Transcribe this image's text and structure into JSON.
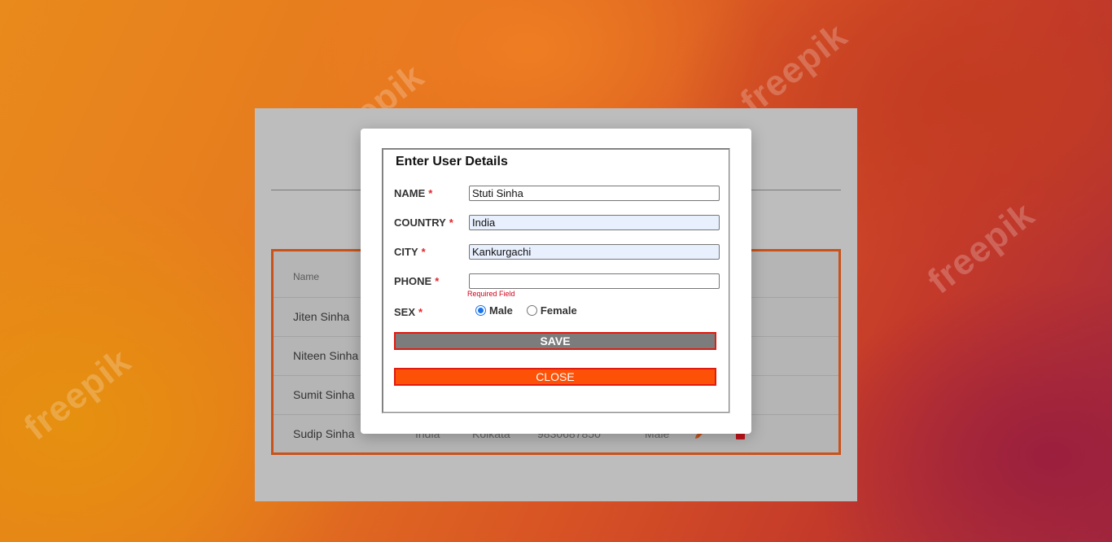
{
  "watermark": "freepik",
  "background_card": {
    "table": {
      "header_name": "Name",
      "rows": [
        {
          "name": "Jiten Sinha"
        },
        {
          "name": "Niteen Sinha"
        },
        {
          "name": "Sumit Sinha"
        },
        {
          "name": "Sudip Sinha",
          "country": "India",
          "city": "Kolkata",
          "phone": "9830687850",
          "sex": "Male"
        }
      ]
    }
  },
  "modal": {
    "title": "Enter User Details",
    "required_mark": "*",
    "name_label": "NAME",
    "name_value": "Stuti Sinha",
    "country_label": "COUNTRY",
    "country_value": "India",
    "city_label": "CITY",
    "city_value": "Kankurgachi",
    "phone_label": "PHONE",
    "phone_value": "",
    "phone_error": "Required Field",
    "sex_label": "SEX",
    "sex_options": [
      "Male",
      "Female"
    ],
    "sex_selected": "Male",
    "save_label": "SAVE",
    "close_label": "CLOSE"
  },
  "colors": {
    "accent_red": "#e01b0f",
    "close_orange": "#fc5107",
    "save_gray": "#7c7c7c",
    "table_border": "#c9521a"
  }
}
